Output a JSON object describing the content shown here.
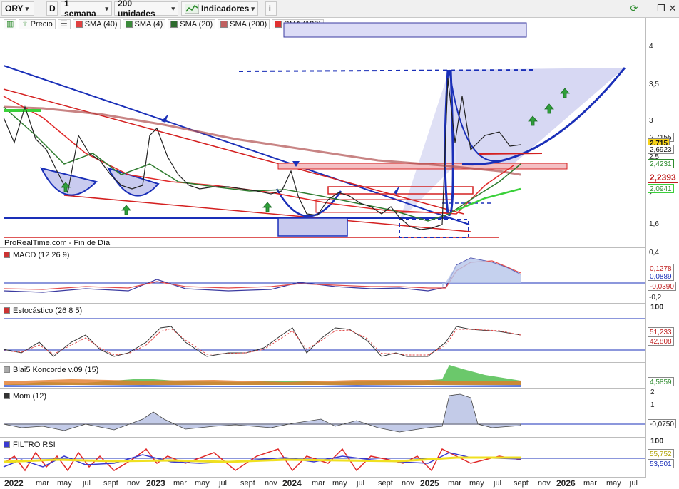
{
  "toolbar": {
    "instrument": "ORY",
    "d_button": "D",
    "period": "1 semana",
    "units": "200 unidades",
    "indicators": "Indicadores",
    "info_icon": "info-icon"
  },
  "legend": {
    "price": "Precio",
    "sma": [
      "SMA (40)",
      "SMA (4)",
      "SMA (20)",
      "SMA (200)",
      "SMA (120)"
    ]
  },
  "price_panel": {
    "credit": "ProRealTime.com - Fin de Día",
    "y_ticks": [
      "4",
      "3,5",
      "3",
      "2,5",
      "2",
      "1,6"
    ],
    "price_labels": [
      "2,7155",
      "2,715",
      "2,6923",
      "2,4231",
      "2,2393",
      "2,0941"
    ]
  },
  "panels": {
    "macd": {
      "title": "MACD (12 26 9)",
      "ticks": [
        "0,4",
        "-0,2"
      ],
      "values": [
        "0,1278",
        "0,0889",
        "-0,0390"
      ]
    },
    "stoch": {
      "title": "Estocástico (26 8 5)",
      "ticks": [
        "100"
      ],
      "values": [
        "51,233",
        "42,808"
      ]
    },
    "koncorde": {
      "title": "Blai5 Koncorde v.09 (15)",
      "values": [
        "4,5859"
      ]
    },
    "mom": {
      "title": "Mom (12)",
      "ticks": [
        "2",
        "1"
      ],
      "values": [
        "-0,0750"
      ]
    },
    "rsi": {
      "title": "FILTRO RSI",
      "ticks": [
        "100"
      ],
      "values": [
        "55,752",
        "53,501"
      ]
    }
  },
  "x_axis": [
    "2022",
    "mar",
    "may",
    "jul",
    "sept",
    "nov",
    "2023",
    "mar",
    "may",
    "jul",
    "sept",
    "nov",
    "2024",
    "mar",
    "may",
    "jul",
    "sept",
    "nov",
    "2025",
    "mar",
    "may",
    "jul",
    "sept",
    "nov",
    "2026",
    "mar",
    "may",
    "jul"
  ],
  "colors": {
    "trend_blue": "#1a2fb8",
    "support_red": "#d42020",
    "sma_red": "#e02828",
    "sma_green": "#2e8b2e",
    "sma_brown": "#b05050",
    "arrow_green": "#2f9e3a",
    "bullish_green": "#22aa22"
  }
}
